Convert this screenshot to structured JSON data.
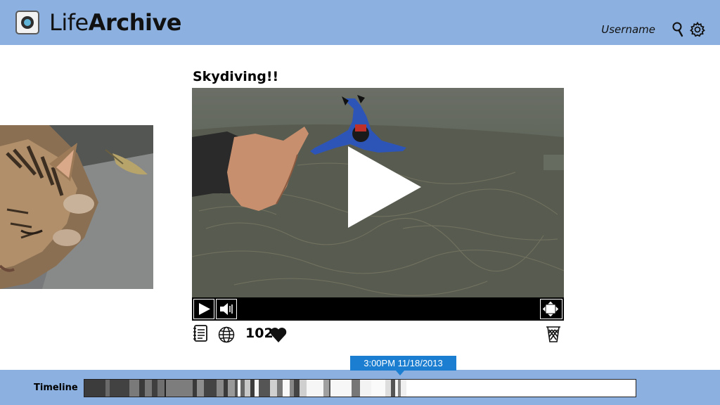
{
  "header": {
    "app_name_light": "Life",
    "app_name_bold": "Archive",
    "username": "Username",
    "icons": [
      "app-logo-icon",
      "search-icon",
      "gear-icon"
    ]
  },
  "post": {
    "title": "Skydiving!!",
    "like_count": "102",
    "action_icons": [
      "notes-icon",
      "globe-icon",
      "heart-icon",
      "trash-icon"
    ],
    "player_icons": [
      "play-icon",
      "volume-icon",
      "fullscreen-icon"
    ]
  },
  "timeline": {
    "label": "Timeline",
    "tooltip": "3:00PM 11/18/2013"
  },
  "colors": {
    "header_bg": "#8cb1e0",
    "tooltip_bg": "#1b7ed0",
    "controls_bg": "#000000"
  }
}
